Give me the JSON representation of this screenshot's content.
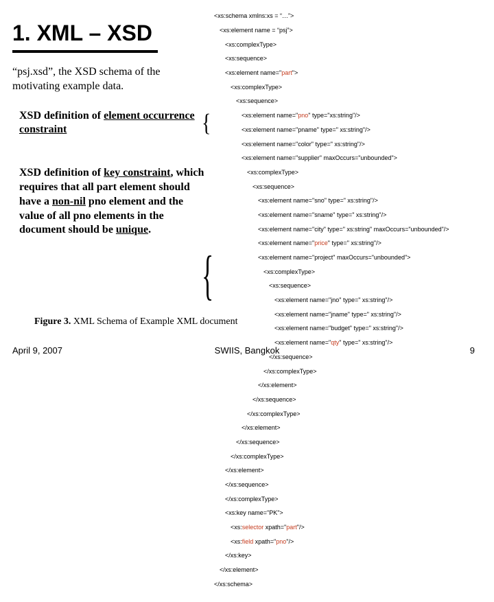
{
  "title": "1. XML – XSD",
  "intro": "“psj.xsd”, the XSD schema of the motivating example data.",
  "sub1_a": "XSD definition of ",
  "sub1_b": "element occurrence constraint",
  "sub2_a": "XSD definition of ",
  "sub2_b": "key constraint",
  "sub2_c": ", which requires that all part element should have a ",
  "sub2_d": "non-nil",
  "sub2_e": " pno element and the value of all pno elements in the document should be ",
  "sub2_f": "unique",
  "sub2_g": ".",
  "fig_label": "Figure 3.",
  "fig_text": " XML Schema of Example XML document",
  "footer_date": "April 9, 2007",
  "footer_venue": "SWIIS, Bangkok",
  "footer_page": "9",
  "code": {
    "l0": "<xs:schema xmlns:xs = “…”>",
    "l1": "<xs:element name = “psj”>",
    "l2": "<xs:complexType>",
    "l3": "<xs:sequence>",
    "l4a": "<xs:element name=\"",
    "l4b": "part",
    "l4c": "\">",
    "l5": "<xs:complexType>",
    "l6": "<xs:sequence>",
    "l7a": "<xs:element name=\"",
    "l7b": "pno",
    "l7c": "\" type=\"xs:string\"/>",
    "l8": "<xs:element name=\"pname\" type=\" xs:string\"/>",
    "l9": "<xs:element name=\"color\" type=\" xs:string\"/>",
    "l10": "<xs:element name=\"supplier\" maxOccurs=\"unbounded\">",
    "l11": "<xs:complexType>",
    "l12": "<xs:sequence>",
    "l13": "<xs:element name=\"sno\" type=\" xs:string\"/>",
    "l14": "<xs:element name=\"sname\" type=\" xs:string\"/>",
    "l15": "<xs:element name=\"city\" type=\" xs:string\" maxOccurs=\"unbounded\"/>",
    "l16a": "<xs:element name=\"",
    "l16b": "price",
    "l16c": "\" type=\" xs:string\"/>",
    "l17": "<xs:element name=\"project\" maxOccurs=\"unbounded\">",
    "l18": "<xs:complexType>",
    "l19": "<xs:sequence>",
    "l20": "<xs:element name=\"jno\" type=\" xs:string\"/>",
    "l21": "<xs:element name=\"jname\" type=\" xs:string\"/>",
    "l22": "<xs:element name=\"budget\" type=\" xs:string\"/>",
    "l23a": "<xs:element name=\"",
    "l23b": "qty",
    "l23c": "\" type=\" xs:string\"/>",
    "l24": "</xs:sequence>",
    "l25": "</xs:complexType>",
    "l26": "</xs:element>",
    "l27": "</xs:sequence>",
    "l28": "</xs:complexType>",
    "l29": "</xs:element>",
    "l30": "</xs:sequence>",
    "l31": "</xs:complexType>",
    "l32": "</xs:element>",
    "l33": "</xs:sequence>",
    "l34": "</xs:complexType>",
    "l35": "<xs:key name=\"PK\">",
    "l36a": "<xs:",
    "l36b": "selector",
    "l36c": " xpath=\"",
    "l36d": "part",
    "l36e": "\"/>",
    "l37a": "<xs:",
    "l37b": "field",
    "l37c": " xpath=\"",
    "l37d": "pno",
    "l37e": "\"/>",
    "l38": "</xs:key>",
    "l39": "</xs:element>",
    "l40": "</xs:schema>"
  }
}
